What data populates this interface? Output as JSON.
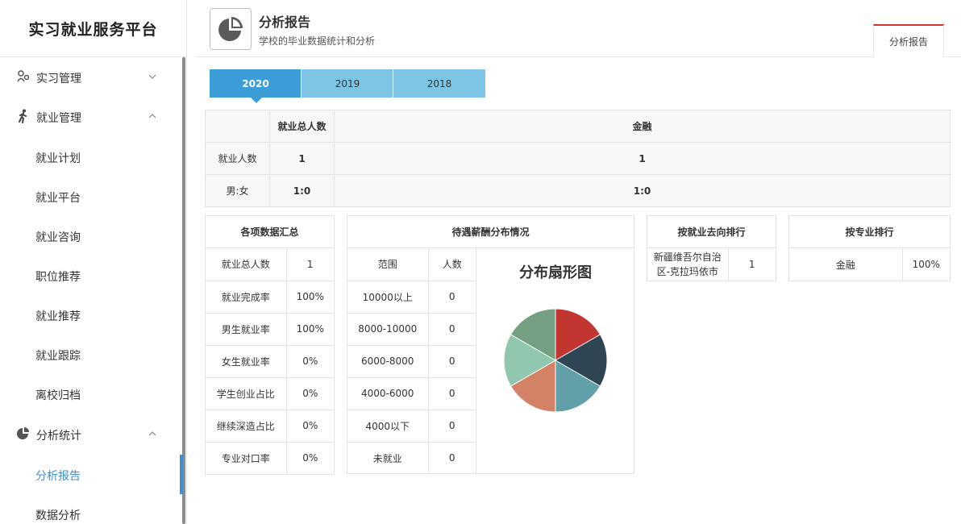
{
  "sidebar": {
    "brand": "实习就业服务平台",
    "groups": [
      {
        "label": "实习管理",
        "icon": "internship-icon",
        "expanded": false
      },
      {
        "label": "就业管理",
        "icon": "walking-person-icon",
        "expanded": true
      },
      {
        "label": "分析统计",
        "icon": "pie-chart-icon",
        "expanded": true
      }
    ],
    "employment_items": [
      "就业计划",
      "就业平台",
      "就业咨询",
      "职位推荐",
      "就业推荐",
      "就业跟踪",
      "离校归档"
    ],
    "analysis_items": [
      "分析报告",
      "数据分析"
    ],
    "active_item": "分析报告"
  },
  "header": {
    "title": "分析报告",
    "subtitle": "学校的毕业数据统计和分析",
    "tab_label": "分析报告",
    "tab_accent": "#d9302b"
  },
  "year_tabs": [
    "2020",
    "2019",
    "2018"
  ],
  "active_year": "2020",
  "summary": {
    "headers": [
      "",
      "就业总人数",
      "金融"
    ],
    "rows": [
      {
        "label": "就业人数",
        "total": "1",
        "finance": "1"
      },
      {
        "label": "男:女",
        "total": "1:0",
        "finance": "1:0"
      }
    ]
  },
  "data_summary": {
    "title": "各项数据汇总",
    "rows": [
      {
        "label": "就业总人数",
        "value": "1"
      },
      {
        "label": "就业完成率",
        "value": "100%"
      },
      {
        "label": "男生就业率",
        "value": "100%"
      },
      {
        "label": "女生就业率",
        "value": "0%"
      },
      {
        "label": "学生创业占比",
        "value": "0%"
      },
      {
        "label": "继续深造占比",
        "value": "0%"
      },
      {
        "label": "专业对口率",
        "value": "0%"
      }
    ]
  },
  "salary": {
    "title": "待遇薪酬分布情况",
    "headers": [
      "范围",
      "人数"
    ],
    "rows": [
      {
        "range": "10000以上",
        "count": "0"
      },
      {
        "range": "8000-10000",
        "count": "0"
      },
      {
        "range": "6000-8000",
        "count": "0"
      },
      {
        "range": "4000-6000",
        "count": "0"
      },
      {
        "range": "4000以下",
        "count": "0"
      },
      {
        "range": "未就业",
        "count": "0"
      }
    ],
    "pie_title": "分布扇形图",
    "pie_colors": [
      "#c23531",
      "#2f4554",
      "#61a0a8",
      "#d48265",
      "#91c7ae",
      "#749f83"
    ]
  },
  "destination_rank": {
    "title": "按就业去向排行",
    "rows": [
      {
        "name": "新疆维吾尔自治区-克拉玛依市",
        "value": "1"
      }
    ]
  },
  "major_rank": {
    "title": "按专业排行",
    "rows": [
      {
        "name": "金融",
        "value": "100%"
      }
    ]
  },
  "colors": {
    "primary": "#3a9dd8",
    "tab_inactive": "#7ec4e4",
    "link_active": "#3d8fd1"
  }
}
